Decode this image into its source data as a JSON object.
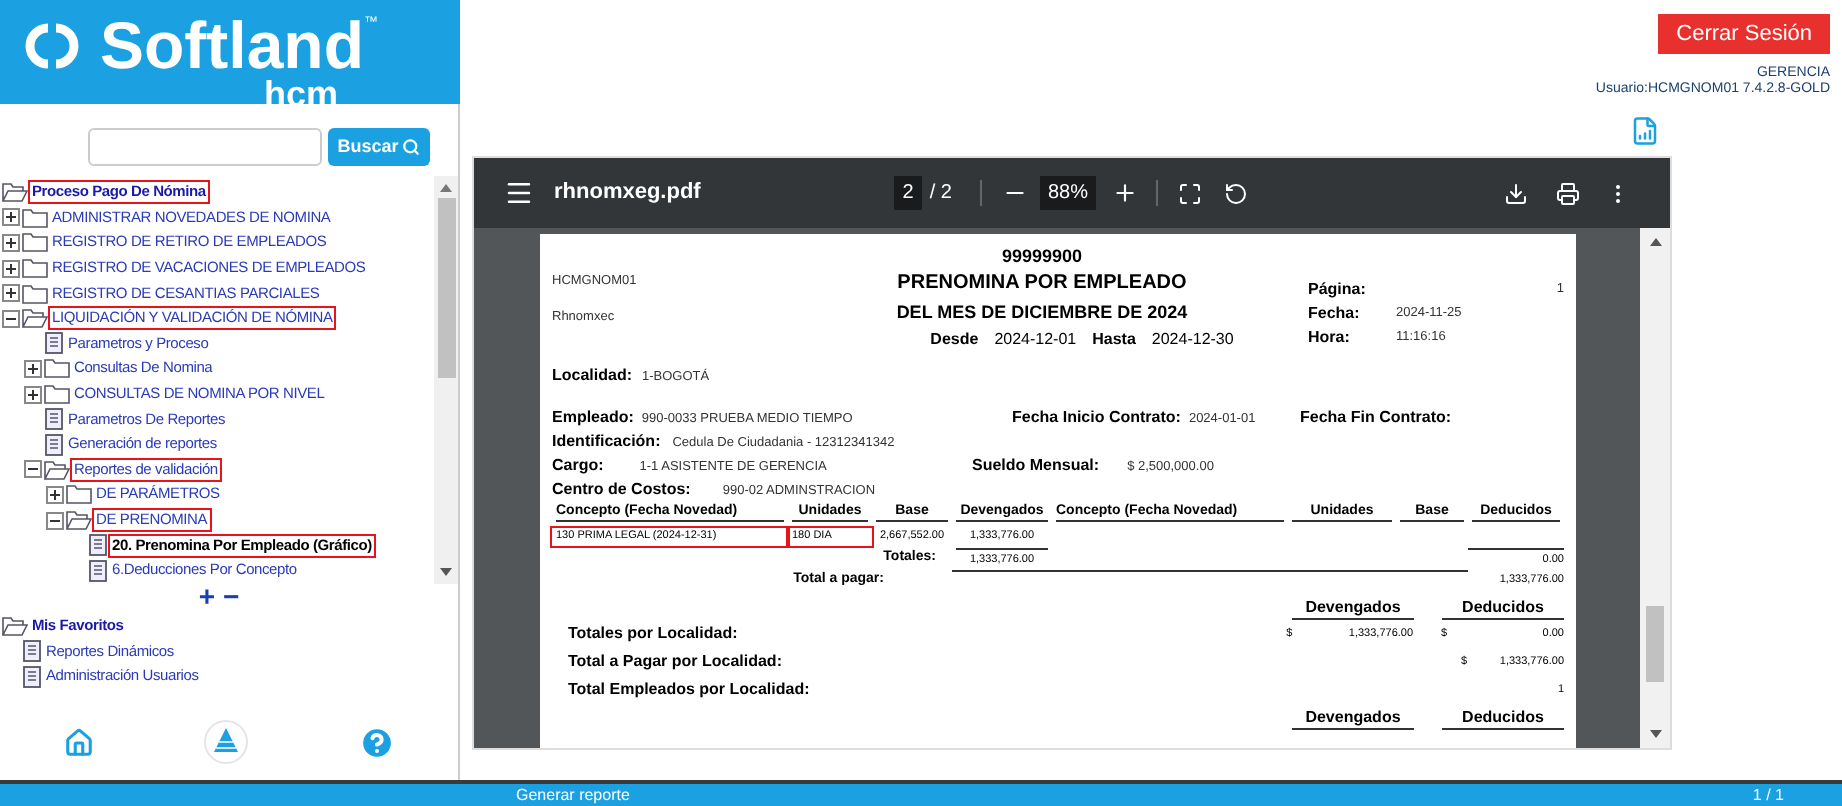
{
  "header": {
    "logo_text": "Softland",
    "logo_tm": "™",
    "logo_sub": "hcm",
    "logout_button": "Cerrar Sesión",
    "role": "GERENCIA",
    "user": "Usuario:HCMGNOM01 7.4.2.8-GOLD"
  },
  "sidebar": {
    "search_button": "Buscar",
    "tree": [
      {
        "label": "Proceso Pago De Nómina",
        "kind": "folder",
        "expanded": true,
        "highlighted": true,
        "selected": false,
        "children": [
          {
            "label": "ADMINISTRAR NOVEDADES DE NOMINA",
            "kind": "folder",
            "expanded": false,
            "highlighted": false,
            "selected": false
          },
          {
            "label": "REGISTRO DE RETIRO DE EMPLEADOS",
            "kind": "folder",
            "expanded": false,
            "highlighted": false,
            "selected": false
          },
          {
            "label": "REGISTRO DE VACACIONES DE EMPLEADOS",
            "kind": "folder",
            "expanded": false,
            "highlighted": false,
            "selected": false
          },
          {
            "label": "REGISTRO DE CESANTIAS PARCIALES",
            "kind": "folder",
            "expanded": false,
            "highlighted": false,
            "selected": false
          },
          {
            "label": "LIQUIDACIÓN Y VALIDACIÓN DE NÓMINA",
            "kind": "folder",
            "expanded": true,
            "highlighted": true,
            "selected": false,
            "children": [
              {
                "label": "Parametros y Proceso",
                "kind": "report",
                "highlighted": false,
                "selected": false
              },
              {
                "label": "Consultas De Nomina",
                "kind": "folder",
                "expanded": false,
                "highlighted": false,
                "selected": false
              },
              {
                "label": "CONSULTAS DE NOMINA POR NIVEL",
                "kind": "folder",
                "expanded": false,
                "highlighted": false,
                "selected": false
              },
              {
                "label": "Parametros De Reportes",
                "kind": "report",
                "highlighted": false,
                "selected": false
              },
              {
                "label": "Generación de reportes",
                "kind": "report",
                "highlighted": false,
                "selected": false
              },
              {
                "label": "Reportes de validación",
                "kind": "folder",
                "expanded": true,
                "highlighted": true,
                "selected": false,
                "children": [
                  {
                    "label": "DE PARÁMETROS",
                    "kind": "folder",
                    "expanded": false,
                    "highlighted": false,
                    "selected": false
                  },
                  {
                    "label": "DE PRENOMINA",
                    "kind": "folder",
                    "expanded": true,
                    "highlighted": true,
                    "selected": false,
                    "children": [
                      {
                        "label": "20. Prenomina Por Empleado (Gráfico)",
                        "kind": "report",
                        "highlighted": true,
                        "selected": true
                      },
                      {
                        "label": "6.Deducciones Por Concepto",
                        "kind": "report",
                        "highlighted": false,
                        "selected": false
                      }
                    ]
                  }
                ]
              }
            ]
          }
        ]
      }
    ],
    "tree_controls": [
      "+",
      "−"
    ],
    "favorites": [
      {
        "label": "Mis Favoritos",
        "kind": "folder",
        "expanded": true,
        "highlighted": false,
        "selected": false,
        "children": [
          {
            "label": "Reportes Dinámicos",
            "kind": "report",
            "highlighted": false,
            "selected": false
          },
          {
            "label": "Administración Usuarios",
            "kind": "report",
            "highlighted": false,
            "selected": false
          }
        ]
      }
    ]
  },
  "pdf_viewer": {
    "file_name": "rhnomxeg.pdf",
    "page_input": "2",
    "page_total": "/ 2",
    "zoom": "88%",
    "page": {
      "report_code": "HCMGNOM01",
      "program": "Rhnomxec",
      "company_code": "99999900",
      "title": "PRENOMINA POR EMPLEADO",
      "period": "DEL MES DE DICIEMBRE DE 2024",
      "range": [
        {
          "label": "Desde",
          "value": "2024-12-01"
        },
        {
          "label": "Hasta",
          "value": "2024-12-30"
        }
      ],
      "meta": [
        {
          "label": "Página:",
          "value": "1"
        },
        {
          "label": "Fecha:",
          "value": "2024-11-25"
        },
        {
          "label": "Hora:",
          "value": "11:16:16"
        }
      ],
      "location": {
        "label": "Localidad:",
        "value": "1-BOGOTÁ"
      },
      "employee": {
        "label": "Empleado:",
        "value": "990-0033 PRUEBA MEDIO TIEMPO"
      },
      "contract_start": {
        "label": "Fecha Inicio Contrato:",
        "value": "2024-01-01"
      },
      "contract_end": {
        "label": "Fecha Fin Contrato:"
      },
      "identification": {
        "label": "Identificación:",
        "value": "Cedula De Ciudadania - 12312341342"
      },
      "position": {
        "label": "Cargo:",
        "value": "1-1 ASISTENTE DE GERENCIA"
      },
      "salary": {
        "label": "Sueldo Mensual:",
        "value": "$ 2,500,000.00"
      },
      "cost_center": {
        "label": "Centro de Costos:",
        "value": "990-02 ADMINSTRACION"
      },
      "columns": [
        "Concepto (Fecha Novedad)",
        "Unidades",
        "Base",
        "Devengados",
        "Concepto (Fecha Novedad)",
        "Unidades",
        "Base",
        "Deducidos"
      ],
      "rows": [
        {
          "cells": [
            {
              "text": "130 PRIMA LEGAL (2024-12-31)",
              "highlighted": true
            },
            {
              "text": "180 DIA",
              "highlighted": true
            },
            {
              "text": "2,667,552.00",
              "highlighted": false
            },
            {
              "text": "1,333,776.00",
              "highlighted": false
            }
          ]
        }
      ],
      "totals": {
        "label": "Totales:",
        "earned": "1,333,776.00",
        "deducted": "0.00"
      },
      "net": {
        "label": "Total a pagar:",
        "value": "1,333,776.00"
      },
      "summary_headers": [
        "Devengados",
        "Deducidos"
      ],
      "summary": [
        {
          "label": "Totales por Localidad:",
          "earned_currency": "$",
          "earned": "1,333,776.00",
          "deducted_currency": "$",
          "deducted": "0.00"
        },
        {
          "label": "Total a Pagar por Localidad:",
          "deducted_currency": "$",
          "deducted": "1,333,776.00"
        },
        {
          "label": "Total Empleados por Localidad:",
          "deducted": "1"
        }
      ],
      "footer_headers": [
        "Devengados",
        "Deducidos"
      ]
    }
  },
  "status_bar": {
    "left": "Generar reporte",
    "right": "1 / 1"
  }
}
